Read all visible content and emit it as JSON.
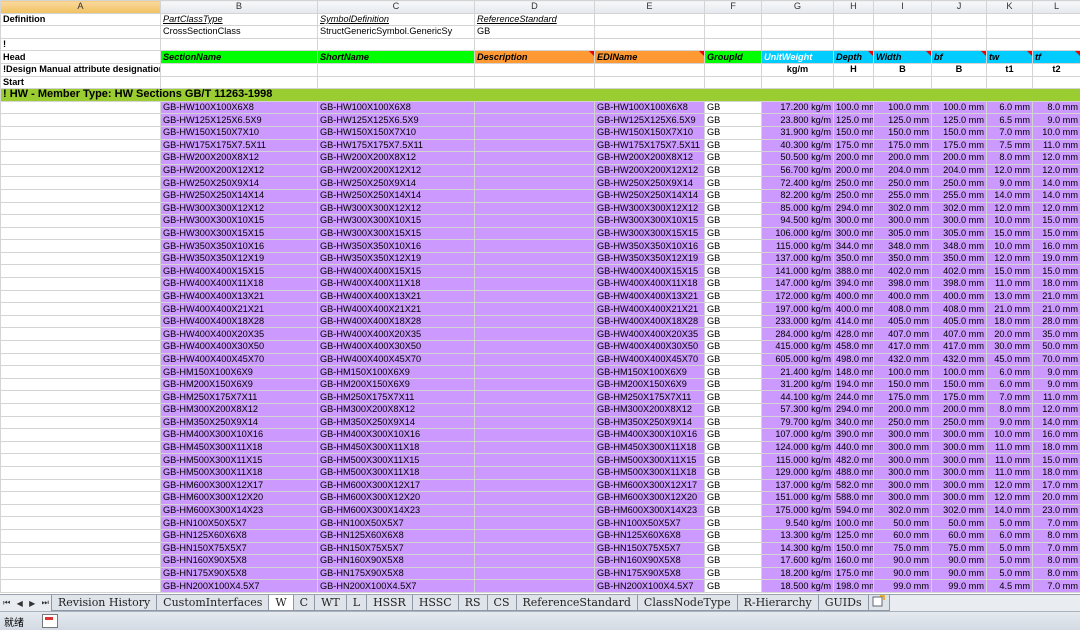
{
  "columns": [
    "A",
    "B",
    "C",
    "D",
    "E",
    "F",
    "G",
    "H",
    "I",
    "J",
    "K",
    "L"
  ],
  "row1": {
    "a": "Definition",
    "b": "PartClassType",
    "c": "SymbolDefinition",
    "d": "ReferenceStandard"
  },
  "row2": {
    "b": "CrossSectionClass",
    "c": "StructGenericSymbol.GenericSy",
    "d": "GB"
  },
  "row3": {
    "a": "!"
  },
  "head": {
    "a": "Head",
    "b": "SectionName",
    "c": "ShortName",
    "d": "Description",
    "e": "EDIName",
    "f": "GroupId",
    "g": "UnitWeight",
    "h": "Depth",
    "i": "Width",
    "j": "bf",
    "k": "tw",
    "l": "tf"
  },
  "design": {
    "a": "!Design Manual attribute designation",
    "g": "kg/m",
    "h": "H",
    "i": "B",
    "j": "B",
    "k": "t1",
    "l": "t2"
  },
  "start": {
    "a": "Start"
  },
  "member_type": "! HW - Member Type: HW Sections GB/T 11263-1998",
  "rows": [
    [
      "GB-HW100X100X6X8",
      "GB-HW100X100X6X8",
      "GB-HW100X100X6X8",
      "GB",
      "17.200 kg/m",
      "100.0 mm",
      "100.0 mm",
      "100.0 mm",
      "6.0 mm",
      "8.0 mm"
    ],
    [
      "GB-HW125X125X6.5X9",
      "GB-HW125X125X6.5X9",
      "GB-HW125X125X6.5X9",
      "GB",
      "23.800 kg/m",
      "125.0 mm",
      "125.0 mm",
      "125.0 mm",
      "6.5 mm",
      "9.0 mm"
    ],
    [
      "GB-HW150X150X7X10",
      "GB-HW150X150X7X10",
      "GB-HW150X150X7X10",
      "GB",
      "31.900 kg/m",
      "150.0 mm",
      "150.0 mm",
      "150.0 mm",
      "7.0 mm",
      "10.0 mm"
    ],
    [
      "GB-HW175X175X7.5X11",
      "GB-HW175X175X7.5X11",
      "GB-HW175X175X7.5X11",
      "GB",
      "40.300 kg/m",
      "175.0 mm",
      "175.0 mm",
      "175.0 mm",
      "7.5 mm",
      "11.0 mm"
    ],
    [
      "GB-HW200X200X8X12",
      "GB-HW200X200X8X12",
      "GB-HW200X200X8X12",
      "GB",
      "50.500 kg/m",
      "200.0 mm",
      "200.0 mm",
      "200.0 mm",
      "8.0 mm",
      "12.0 mm"
    ],
    [
      "GB-HW200X200X12X12",
      "GB-HW200X200X12X12",
      "GB-HW200X200X12X12",
      "GB",
      "56.700 kg/m",
      "200.0 mm",
      "204.0 mm",
      "204.0 mm",
      "12.0 mm",
      "12.0 mm"
    ],
    [
      "GB-HW250X250X9X14",
      "GB-HW250X250X9X14",
      "GB-HW250X250X9X14",
      "GB",
      "72.400 kg/m",
      "250.0 mm",
      "250.0 mm",
      "250.0 mm",
      "9.0 mm",
      "14.0 mm"
    ],
    [
      "GB-HW250X250X14X14",
      "GB-HW250X250X14X14",
      "GB-HW250X250X14X14",
      "GB",
      "82.200 kg/m",
      "250.0 mm",
      "255.0 mm",
      "255.0 mm",
      "14.0 mm",
      "14.0 mm"
    ],
    [
      "GB-HW300X300X12X12",
      "GB-HW300X300X12X12",
      "GB-HW300X300X12X12",
      "GB",
      "85.000 kg/m",
      "294.0 mm",
      "302.0 mm",
      "302.0 mm",
      "12.0 mm",
      "12.0 mm"
    ],
    [
      "GB-HW300X300X10X15",
      "GB-HW300X300X10X15",
      "GB-HW300X300X10X15",
      "GB",
      "94.500 kg/m",
      "300.0 mm",
      "300.0 mm",
      "300.0 mm",
      "10.0 mm",
      "15.0 mm"
    ],
    [
      "GB-HW300X300X15X15",
      "GB-HW300X300X15X15",
      "GB-HW300X300X15X15",
      "GB",
      "106.000 kg/m",
      "300.0 mm",
      "305.0 mm",
      "305.0 mm",
      "15.0 mm",
      "15.0 mm"
    ],
    [
      "GB-HW350X350X10X16",
      "GB-HW350X350X10X16",
      "GB-HW350X350X10X16",
      "GB",
      "115.000 kg/m",
      "344.0 mm",
      "348.0 mm",
      "348.0 mm",
      "10.0 mm",
      "16.0 mm"
    ],
    [
      "GB-HW350X350X12X19",
      "GB-HW350X350X12X19",
      "GB-HW350X350X12X19",
      "GB",
      "137.000 kg/m",
      "350.0 mm",
      "350.0 mm",
      "350.0 mm",
      "12.0 mm",
      "19.0 mm"
    ],
    [
      "GB-HW400X400X15X15",
      "GB-HW400X400X15X15",
      "GB-HW400X400X15X15",
      "GB",
      "141.000 kg/m",
      "388.0 mm",
      "402.0 mm",
      "402.0 mm",
      "15.0 mm",
      "15.0 mm"
    ],
    [
      "GB-HW400X400X11X18",
      "GB-HW400X400X11X18",
      "GB-HW400X400X11X18",
      "GB",
      "147.000 kg/m",
      "394.0 mm",
      "398.0 mm",
      "398.0 mm",
      "11.0 mm",
      "18.0 mm"
    ],
    [
      "GB-HW400X400X13X21",
      "GB-HW400X400X13X21",
      "GB-HW400X400X13X21",
      "GB",
      "172.000 kg/m",
      "400.0 mm",
      "400.0 mm",
      "400.0 mm",
      "13.0 mm",
      "21.0 mm"
    ],
    [
      "GB-HW400X400X21X21",
      "GB-HW400X400X21X21",
      "GB-HW400X400X21X21",
      "GB",
      "197.000 kg/m",
      "400.0 mm",
      "408.0 mm",
      "408.0 mm",
      "21.0 mm",
      "21.0 mm"
    ],
    [
      "GB-HW400X400X18X28",
      "GB-HW400X400X18X28",
      "GB-HW400X400X18X28",
      "GB",
      "233.000 kg/m",
      "414.0 mm",
      "405.0 mm",
      "405.0 mm",
      "18.0 mm",
      "28.0 mm"
    ],
    [
      "GB-HW400X400X20X35",
      "GB-HW400X400X20X35",
      "GB-HW400X400X20X35",
      "GB",
      "284.000 kg/m",
      "428.0 mm",
      "407.0 mm",
      "407.0 mm",
      "20.0 mm",
      "35.0 mm"
    ],
    [
      "GB-HW400X400X30X50",
      "GB-HW400X400X30X50",
      "GB-HW400X400X30X50",
      "GB",
      "415.000 kg/m",
      "458.0 mm",
      "417.0 mm",
      "417.0 mm",
      "30.0 mm",
      "50.0 mm"
    ],
    [
      "GB-HW400X400X45X70",
      "GB-HW400X400X45X70",
      "GB-HW400X400X45X70",
      "GB",
      "605.000 kg/m",
      "498.0 mm",
      "432.0 mm",
      "432.0 mm",
      "45.0 mm",
      "70.0 mm"
    ],
    [
      "GB-HM150X100X6X9",
      "GB-HM150X100X6X9",
      "GB-HM150X100X6X9",
      "GB",
      "21.400 kg/m",
      "148.0 mm",
      "100.0 mm",
      "100.0 mm",
      "6.0 mm",
      "9.0 mm"
    ],
    [
      "GB-HM200X150X6X9",
      "GB-HM200X150X6X9",
      "GB-HM200X150X6X9",
      "GB",
      "31.200 kg/m",
      "194.0 mm",
      "150.0 mm",
      "150.0 mm",
      "6.0 mm",
      "9.0 mm"
    ],
    [
      "GB-HM250X175X7X11",
      "GB-HM250X175X7X11",
      "GB-HM250X175X7X11",
      "GB",
      "44.100 kg/m",
      "244.0 mm",
      "175.0 mm",
      "175.0 mm",
      "7.0 mm",
      "11.0 mm"
    ],
    [
      "GB-HM300X200X8X12",
      "GB-HM300X200X8X12",
      "GB-HM300X200X8X12",
      "GB",
      "57.300 kg/m",
      "294.0 mm",
      "200.0 mm",
      "200.0 mm",
      "8.0 mm",
      "12.0 mm"
    ],
    [
      "GB-HM350X250X9X14",
      "GB-HM350X250X9X14",
      "GB-HM350X250X9X14",
      "GB",
      "79.700 kg/m",
      "340.0 mm",
      "250.0 mm",
      "250.0 mm",
      "9.0 mm",
      "14.0 mm"
    ],
    [
      "GB-HM400X300X10X16",
      "GB-HM400X300X10X16",
      "GB-HM400X300X10X16",
      "GB",
      "107.000 kg/m",
      "390.0 mm",
      "300.0 mm",
      "300.0 mm",
      "10.0 mm",
      "16.0 mm"
    ],
    [
      "GB-HM450X300X11X18",
      "GB-HM450X300X11X18",
      "GB-HM450X300X11X18",
      "GB",
      "124.000 kg/m",
      "440.0 mm",
      "300.0 mm",
      "300.0 mm",
      "11.0 mm",
      "18.0 mm"
    ],
    [
      "GB-HM500X300X11X15",
      "GB-HM500X300X11X15",
      "GB-HM500X300X11X15",
      "GB",
      "115.000 kg/m",
      "482.0 mm",
      "300.0 mm",
      "300.0 mm",
      "11.0 mm",
      "15.0 mm"
    ],
    [
      "GB-HM500X300X11X18",
      "GB-HM500X300X11X18",
      "GB-HM500X300X11X18",
      "GB",
      "129.000 kg/m",
      "488.0 mm",
      "300.0 mm",
      "300.0 mm",
      "11.0 mm",
      "18.0 mm"
    ],
    [
      "GB-HM600X300X12X17",
      "GB-HM600X300X12X17",
      "GB-HM600X300X12X17",
      "GB",
      "137.000 kg/m",
      "582.0 mm",
      "300.0 mm",
      "300.0 mm",
      "12.0 mm",
      "17.0 mm"
    ],
    [
      "GB-HM600X300X12X20",
      "GB-HM600X300X12X20",
      "GB-HM600X300X12X20",
      "GB",
      "151.000 kg/m",
      "588.0 mm",
      "300.0 mm",
      "300.0 mm",
      "12.0 mm",
      "20.0 mm"
    ],
    [
      "GB-HM600X300X14X23",
      "GB-HM600X300X14X23",
      "GB-HM600X300X14X23",
      "GB",
      "175.000 kg/m",
      "594.0 mm",
      "302.0 mm",
      "302.0 mm",
      "14.0 mm",
      "23.0 mm"
    ],
    [
      "GB-HN100X50X5X7",
      "GB-HN100X50X5X7",
      "GB-HN100X50X5X7",
      "GB",
      "9.540 kg/m",
      "100.0 mm",
      "50.0 mm",
      "50.0 mm",
      "5.0 mm",
      "7.0 mm"
    ],
    [
      "GB-HN125X60X6X8",
      "GB-HN125X60X6X8",
      "GB-HN125X60X6X8",
      "GB",
      "13.300 kg/m",
      "125.0 mm",
      "60.0 mm",
      "60.0 mm",
      "6.0 mm",
      "8.0 mm"
    ],
    [
      "GB-HN150X75X5X7",
      "GB-HN150X75X5X7",
      "GB-HN150X75X5X7",
      "GB",
      "14.300 kg/m",
      "150.0 mm",
      "75.0 mm",
      "75.0 mm",
      "5.0 mm",
      "7.0 mm"
    ],
    [
      "GB-HN160X90X5X8",
      "GB-HN160X90X5X8",
      "GB-HN160X90X5X8",
      "GB",
      "17.600 kg/m",
      "160.0 mm",
      "90.0 mm",
      "90.0 mm",
      "5.0 mm",
      "8.0 mm"
    ],
    [
      "GB-HN175X90X5X8",
      "GB-HN175X90X5X8",
      "GB-HN175X90X5X8",
      "GB",
      "18.200 kg/m",
      "175.0 mm",
      "90.0 mm",
      "90.0 mm",
      "5.0 mm",
      "8.0 mm"
    ],
    [
      "GB-HN200X100X4.5X7",
      "GB-HN200X100X4.5X7",
      "GB-HN200X100X4.5X7",
      "GB",
      "18.500 kg/m",
      "198.0 mm",
      "99.0 mm",
      "99.0 mm",
      "4.5 mm",
      "7.0 mm"
    ]
  ],
  "tabs": [
    "Revision History",
    "CustomInterfaces",
    "W",
    "C",
    "WT",
    "L",
    "HSSR",
    "HSSC",
    "RS",
    "CS",
    "ReferenceStandard",
    "ClassNodeType",
    "R-Hierarchy",
    "GUIDs"
  ],
  "active_tab": "W",
  "nav_buttons": [
    "⏮",
    "◀",
    "▶",
    "⏭"
  ],
  "status": {
    "ready": "就绪"
  }
}
